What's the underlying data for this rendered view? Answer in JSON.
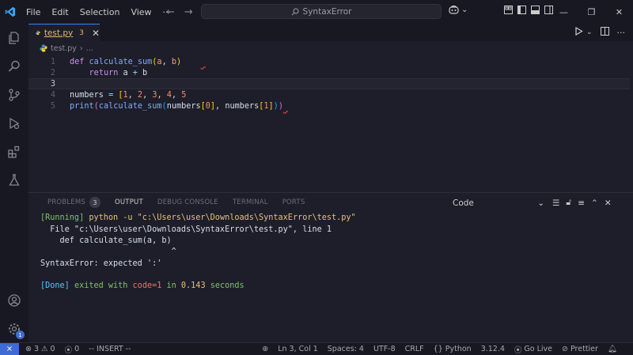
{
  "menu": [
    "File",
    "Edit",
    "Selection",
    "View",
    "···"
  ],
  "search": {
    "label": "SyntaxError"
  },
  "tab": {
    "name": "test.py",
    "problems": "3",
    "close": "✕"
  },
  "breadcrumb": {
    "file": "test.py",
    "rest": "..."
  },
  "editor": {
    "line_numbers": [
      "1",
      "2",
      "3",
      "4",
      "5"
    ],
    "current_line": 3
  },
  "panel": {
    "tabs": [
      "PROBLEMS",
      "OUTPUT",
      "DEBUG CONSOLE",
      "TERMINAL",
      "PORTS"
    ],
    "problems_count": "3",
    "active_tab": "OUTPUT",
    "channel": "Code",
    "output": {
      "running_tag": "[Running]",
      "running_cmd": " python -u \"c:\\Users\\user\\Downloads\\SyntaxError\\test.py\"",
      "file_line": "  File \"c:\\Users\\user\\Downloads\\SyntaxError\\test.py\", line 1",
      "code_line": "    def calculate_sum(a, b)",
      "caret": "                           ^",
      "error": "SyntaxError: expected ':'",
      "done_tag": "[Done]",
      "done_exited": " exited with ",
      "done_code": "code=1",
      "done_in": " in ",
      "done_time": "0.143",
      "done_seconds": " seconds"
    }
  },
  "status": {
    "errors": "3",
    "warnings": "0",
    "ports": "0",
    "mode": "-- INSERT --",
    "position": "Ln 3, Col 1",
    "spaces": "Spaces: 4",
    "encoding": "UTF-8",
    "eol": "CRLF",
    "language": "Python",
    "version": "3.12.4",
    "golive": "Go Live",
    "prettier": "Prettier"
  },
  "accounts_badge": "1",
  "colors": {
    "accent": "#3e6bd6",
    "error": "#f44747"
  }
}
